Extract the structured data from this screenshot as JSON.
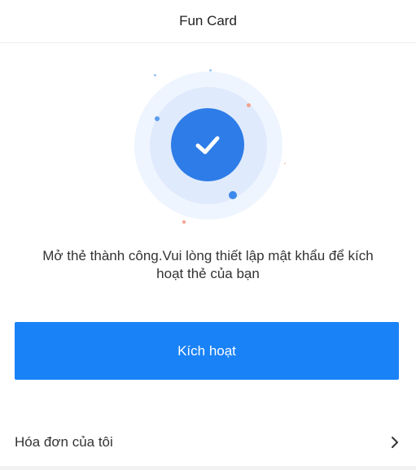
{
  "header": {
    "title": "Fun Card"
  },
  "status": {
    "icon": "checkmark-icon",
    "message_line1": "Mở thẻ thành công.Vui lòng thiết lập mật khẩu để kích",
    "message_line2": "hoạt thẻ của bạn"
  },
  "actions": {
    "activate_label": "Kích hoạt"
  },
  "menu": {
    "invoice_label": "Hóa đơn của tôi",
    "invoice_icon": "chevron-right-icon"
  },
  "colors": {
    "primary": "#1a82f7",
    "check_circle": "#2d7ce8",
    "ring_light": "#eef5fe",
    "ring_mid": "#dfeafc",
    "accent_dot": "#f4a18e"
  }
}
